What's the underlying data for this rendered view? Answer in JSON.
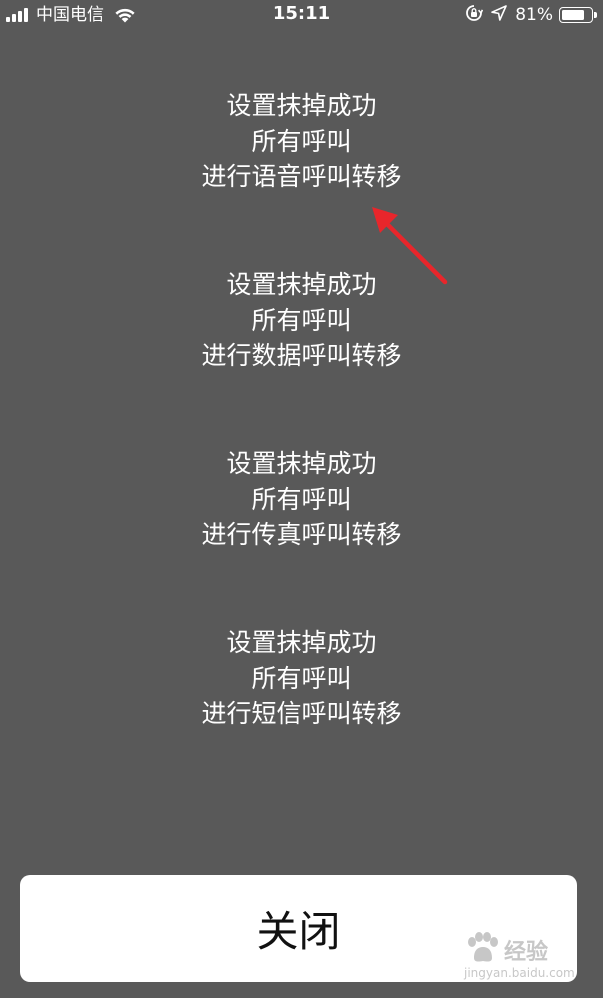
{
  "status_bar": {
    "carrier": "中国电信",
    "time": "15:11",
    "battery_percent": "81%",
    "battery_level": 0.81,
    "icons": [
      "signal-icon",
      "wifi-icon",
      "rotation-lock-icon",
      "location-icon",
      "battery-icon"
    ]
  },
  "messages": [
    {
      "lines": [
        "设置抹掉成功",
        "所有呼叫",
        "进行语音呼叫转移"
      ]
    },
    {
      "lines": [
        "设置抹掉成功",
        "所有呼叫",
        "进行数据呼叫转移"
      ]
    },
    {
      "lines": [
        "设置抹掉成功",
        "所有呼叫",
        "进行传真呼叫转移"
      ]
    },
    {
      "lines": [
        "设置抹掉成功",
        "所有呼叫",
        "进行短信呼叫转移"
      ]
    }
  ],
  "close_button": {
    "label": "关闭"
  },
  "watermark": {
    "line1": "经验",
    "line2": "jingyan.baidu.com"
  },
  "colors": {
    "background": "#595959",
    "text": "#ffffff",
    "button_bg": "#ffffff",
    "button_text": "#111111",
    "annotation_arrow": "#e8262b"
  }
}
